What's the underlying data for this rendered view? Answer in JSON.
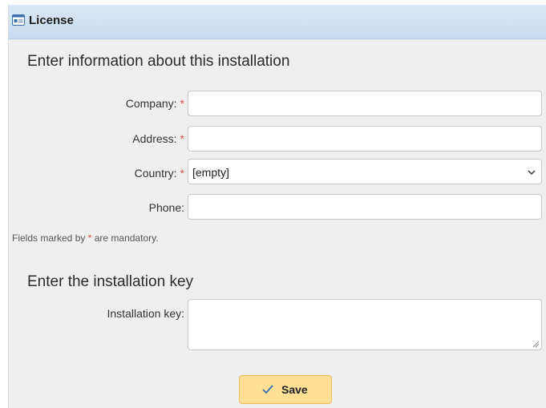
{
  "header": {
    "title": "License",
    "icon": "license-card-icon"
  },
  "sections": {
    "installation_info_title": "Enter information about this installation",
    "installation_key_title": "Enter the installation key"
  },
  "form": {
    "company_label": "Company:",
    "address_label": "Address:",
    "country_label": "Country:",
    "phone_label": "Phone:",
    "required_marker": "*",
    "company_value": "",
    "address_value": "",
    "country_value": "[empty]",
    "phone_value": "",
    "installation_key_label": "Installation key:",
    "installation_key_value": ""
  },
  "note": {
    "prefix": "Fields marked by",
    "marker": "*",
    "suffix": "are mandatory."
  },
  "actions": {
    "save_label": "Save"
  },
  "colors": {
    "header_bg": "#c9dcf1",
    "required": "#d9534f",
    "save_bg": "#fddf96"
  }
}
